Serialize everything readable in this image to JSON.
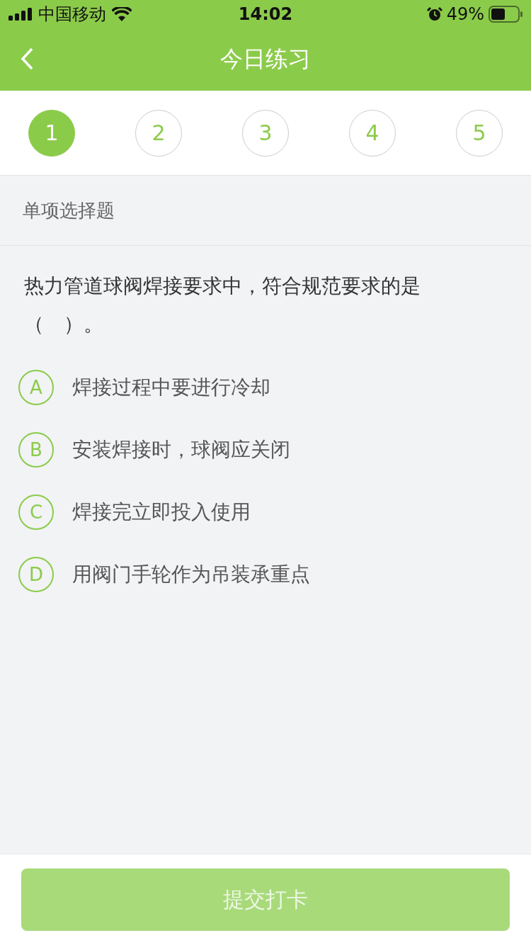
{
  "status_bar": {
    "carrier": "中国移动",
    "time": "14:02",
    "battery": "49%"
  },
  "nav_bar": {
    "title": "今日练习"
  },
  "question_tabs": [
    {
      "label": "1",
      "selected": true
    },
    {
      "label": "2",
      "selected": false
    },
    {
      "label": "3",
      "selected": false
    },
    {
      "label": "4",
      "selected": false
    },
    {
      "label": "5",
      "selected": false
    }
  ],
  "question_type": "单项选择题",
  "question": "热力管道球阀焊接要求中，符合规范要求的是（　）。",
  "options": [
    {
      "letter": "A",
      "text": "焊接过程中要进行冷却",
      "selected": false
    },
    {
      "letter": "B",
      "text": "安装焊接时，球阀应关闭",
      "selected": false
    },
    {
      "letter": "C",
      "text": "焊接完立即投入使用",
      "selected": false
    },
    {
      "letter": "D",
      "text": "用阀门手轮作为吊装承重点",
      "selected": false
    }
  ],
  "submit_button": {
    "label": "提交打卡",
    "disabled": true
  }
}
